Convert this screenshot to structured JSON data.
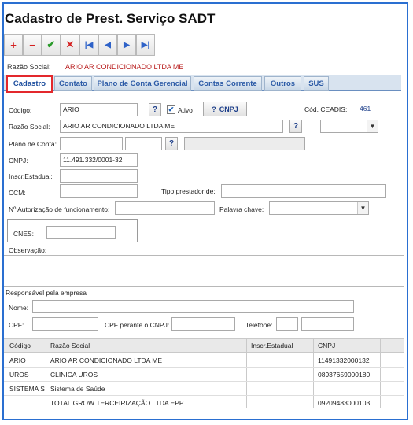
{
  "title": "Cadastro de Prest. Serviço SADT",
  "toolbar": {
    "add": "+",
    "remove": "−",
    "confirm": "✔",
    "cancel": "✕",
    "first": "|◀",
    "prev": "◀",
    "next": "▶",
    "last": "▶|"
  },
  "razao_header": {
    "label": "Razão Social:",
    "value": "ARIO AR CONDICIONADO LTDA ME"
  },
  "tabs": [
    "Cadastro",
    "Contato",
    "Plano de Conta Gerencial",
    "Contas Corrente",
    "Outros",
    "SUS"
  ],
  "form": {
    "codigo_label": "Código:",
    "codigo_value": "ARIO",
    "ativo_label": "Ativo",
    "ativo_checked": "✔",
    "cnpj_button": "CNPJ",
    "help": "?",
    "ceadis_label": "Cód. CEADIS:",
    "ceadis_value": "461",
    "razao_label": "Razão Social:",
    "razao_value": "ARIO AR CONDICIONADO LTDA ME",
    "plano_label": "Plano de Conta:",
    "cnpj_label": "CNPJ:",
    "cnpj_value": "11.491.332/0001-32",
    "inscr_label": "Inscr.Estadual:",
    "ccm_label": "CCM:",
    "tipo_label": "Tipo prestador de:",
    "autorizacao_label": "Nº Autorização de funcionamento:",
    "palavra_label": "Palavra chave:",
    "cnes_label": "CNES:",
    "obs_label": "Observação:",
    "dropdown_arrow": "▼"
  },
  "responsavel": {
    "section_label": "Responsável pela empresa",
    "nome_label": "Nome:",
    "cpf_label": "CPF:",
    "cpf_cnpj_label": "CPF perante o CNPJ:",
    "telefone_label": "Telefone:"
  },
  "grid": {
    "columns": [
      "Código",
      "Razão Social",
      "Inscr.Estadual",
      "CNPJ"
    ],
    "rows": [
      [
        "ARIO",
        "ARIO AR CONDICIONADO LTDA ME",
        "",
        "11491332000132"
      ],
      [
        "UROS",
        "CLINICA UROS",
        "",
        "08937659000180"
      ],
      [
        "SISTEMA SA",
        "Sistema de Saúde",
        "",
        ""
      ],
      [
        "",
        "TOTAL GROW TERCEIRIZAÇÃO LTDA EPP",
        "",
        "09209483000103"
      ]
    ]
  },
  "colors": {
    "accent": "#2a6fd1",
    "tab_highlight": "#e3282c",
    "razao_value": "#b81a1a"
  }
}
